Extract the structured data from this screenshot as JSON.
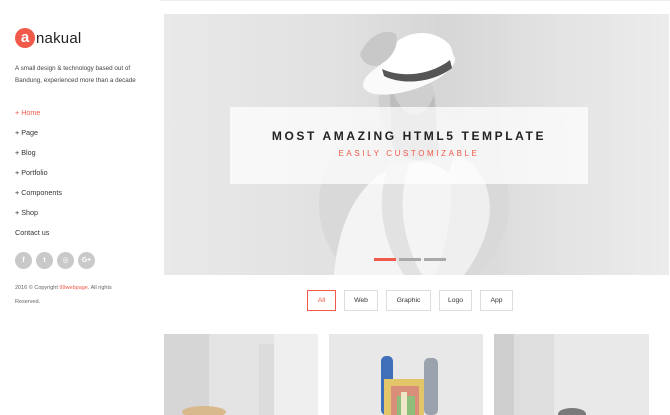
{
  "brand": {
    "logo_letter": "a",
    "name": "nakual",
    "accent": "#f15a4a"
  },
  "sidebar": {
    "tagline": "A small design & technology based out of Bandung, experienced more than a decade",
    "nav": [
      {
        "label": "+ Home",
        "active": true
      },
      {
        "label": "+ Page"
      },
      {
        "label": "+ Blog"
      },
      {
        "label": "+ Portfolio"
      },
      {
        "label": "+ Components"
      },
      {
        "label": "+ Shop"
      },
      {
        "label": "Contact us"
      }
    ],
    "social": [
      {
        "glyph": "f",
        "icon": "facebook-icon"
      },
      {
        "glyph": "t",
        "icon": "twitter-icon"
      },
      {
        "glyph": "◎",
        "icon": "dribbble-icon"
      },
      {
        "glyph": "G+",
        "icon": "google-plus-icon"
      }
    ],
    "copyright": {
      "prefix": "2016 © Copyright ",
      "brand": "99webpage",
      "suffix": ". All rights Reserved."
    }
  },
  "hero": {
    "title": "MOST AMAZING HTML5 TEMPLATE",
    "subtitle": "EASILY CUSTOMIZABLE",
    "slide_count": 3,
    "active_slide": 1
  },
  "filters": [
    {
      "label": "All",
      "active": true
    },
    {
      "label": "Web"
    },
    {
      "label": "Graphic"
    },
    {
      "label": "Logo"
    },
    {
      "label": "App"
    }
  ]
}
